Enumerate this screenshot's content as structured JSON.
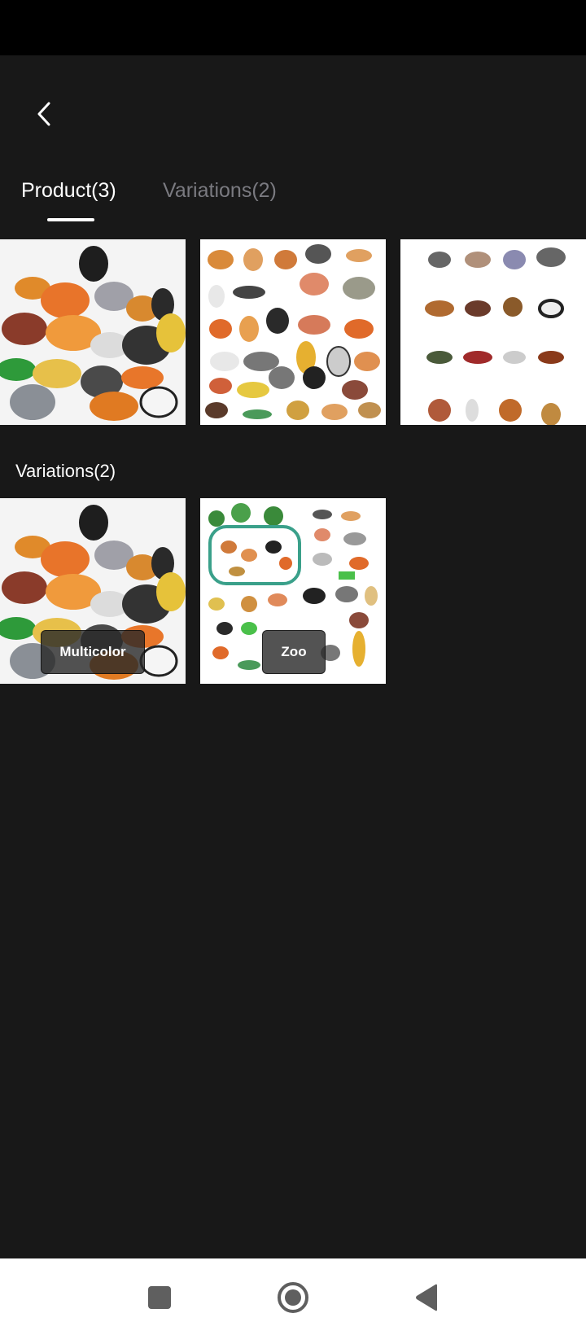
{
  "tabs": [
    {
      "label": "Product(3)",
      "active": true
    },
    {
      "label": "Variations(2)",
      "active": false
    }
  ],
  "product_images": [
    {
      "alt": "Animal toy figures pile"
    },
    {
      "alt": "Animal toy figures grid"
    },
    {
      "alt": "Animal toy figures rows"
    }
  ],
  "variations": {
    "title": "Variations(2)",
    "items": [
      {
        "label": "Multicolor"
      },
      {
        "label": "Zoo"
      }
    ]
  },
  "icons": {
    "back": "back-arrow-icon",
    "nav_recent": "square-icon",
    "nav_home": "circle-icon",
    "nav_back": "triangle-back-icon"
  },
  "colors": {
    "background": "#181818",
    "status_bar": "#000000",
    "active_tab": "#ffffff",
    "inactive_tab": "#7a7a80",
    "nav_bar": "#ffffff",
    "nav_icon": "#5f5f5f"
  }
}
